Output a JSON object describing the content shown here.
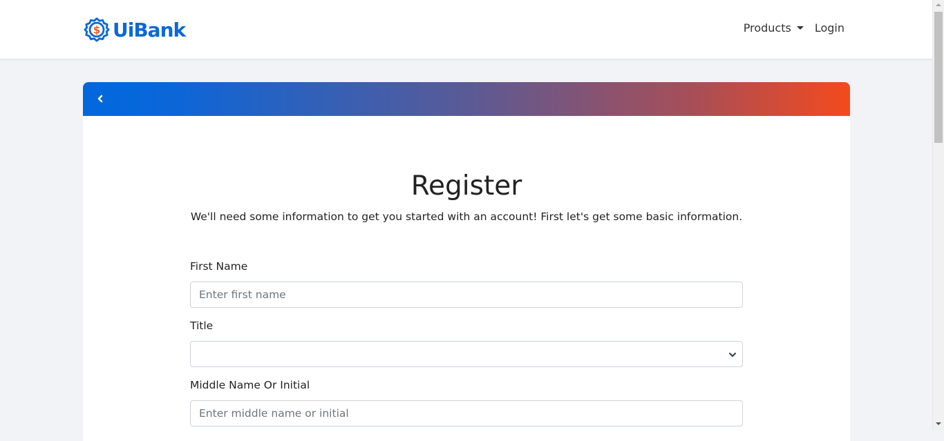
{
  "navbar": {
    "brand": "UiBank",
    "links": {
      "products": "Products",
      "login": "Login"
    }
  },
  "colors": {
    "brand_blue": "#0b68d8",
    "brand_orange": "#f05a22",
    "header_gradient_start": "#0068dd",
    "header_gradient_end": "#f44a1d"
  },
  "icons": {
    "back": "chevron-left-icon",
    "logo": "dollar-badge-icon",
    "dropdown": "caret-down-icon",
    "select": "chevron-down-icon"
  },
  "register": {
    "title": "Register",
    "subtitle": "We'll need some information to get you started with an account! First let's get some basic information.",
    "fields": {
      "first_name": {
        "label": "First Name",
        "placeholder": "Enter first name",
        "value": ""
      },
      "title": {
        "label": "Title",
        "value": ""
      },
      "middle_name": {
        "label": "Middle Name Or Initial",
        "placeholder": "Enter middle name or initial",
        "value": ""
      }
    }
  }
}
